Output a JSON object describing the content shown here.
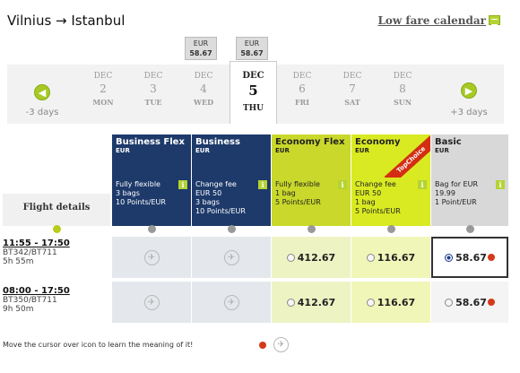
{
  "header": {
    "route": "Vilnius → Istanbul",
    "low_fare_calendar": "Low fare calendar"
  },
  "date_nav": {
    "prev_label": "-3 days",
    "next_label": "+3 days",
    "price_tags": [
      {
        "currency": "EUR",
        "amount": "58.67"
      },
      {
        "currency": "EUR",
        "amount": "58.67"
      }
    ],
    "dates": [
      {
        "month": "DEC",
        "day": "2",
        "weekday": "MON"
      },
      {
        "month": "DEC",
        "day": "3",
        "weekday": "TUE"
      },
      {
        "month": "DEC",
        "day": "4",
        "weekday": "WED"
      },
      {
        "month": "DEC",
        "day": "5",
        "weekday": "THU"
      },
      {
        "month": "DEC",
        "day": "6",
        "weekday": "FRI"
      },
      {
        "month": "DEC",
        "day": "7",
        "weekday": "SAT"
      },
      {
        "month": "DEC",
        "day": "8",
        "weekday": "SUN"
      }
    ],
    "selected_index": 3
  },
  "table": {
    "flight_details_label": "Flight details",
    "columns": [
      {
        "name": "Business Flex",
        "currency": "EUR",
        "desc": [
          "Fully flexible",
          "3 bags",
          "10 Points/EUR"
        ]
      },
      {
        "name": "Business",
        "currency": "EUR",
        "desc": [
          "Change fee",
          "EUR 50",
          "3 bags",
          "10 Points/EUR"
        ]
      },
      {
        "name": "Economy Flex",
        "currency": "EUR",
        "desc": [
          "Fully flexible",
          "1 bag",
          "5 Points/EUR"
        ]
      },
      {
        "name": "Economy",
        "currency": "EUR",
        "desc": [
          "Change fee",
          "EUR 50",
          "1 bag",
          "5 Points/EUR"
        ],
        "badge": "TopChoice"
      },
      {
        "name": "Basic",
        "currency": "EUR",
        "desc": [
          "Bag for EUR",
          "19.99",
          "1 Point/EUR"
        ]
      }
    ],
    "flights": [
      {
        "time": "11:55 - 17:50",
        "flights": "BT342/BT711",
        "duration": "5h 55m",
        "prices": [
          "",
          "",
          "412.67",
          "116.67",
          "58.67"
        ],
        "selected": 4
      },
      {
        "time": "08:00 - 17:50",
        "flights": "BT350/BT711",
        "duration": "9h 50m",
        "prices": [
          "",
          "",
          "412.67",
          "116.67",
          "58.67"
        ],
        "selected": -1
      }
    ]
  },
  "footer": {
    "hint": "Move the cursor over icon to learn the meaning of it!"
  },
  "colors": {
    "business": "#1d3a6a",
    "economy": "#d4e12a",
    "basic": "#d8d8d8",
    "accent_green": "#a6c925"
  }
}
